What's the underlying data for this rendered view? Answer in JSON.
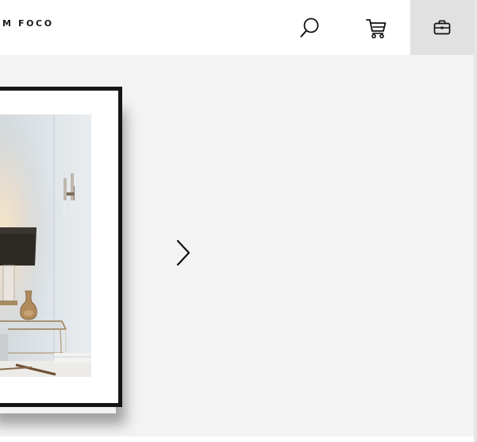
{
  "header": {
    "brand": "M FOCO",
    "icons": {
      "search": "search-icon",
      "cart": "cart-icon",
      "bag": "briefcase-icon"
    }
  },
  "carousel": {
    "next_icon": "chevron-right-icon",
    "image": "framed-photo-living-room-lamp"
  },
  "colors": {
    "page_bg": "#f3f3f3",
    "header_bg": "#ffffff",
    "active_button_bg": "#e1e1e1",
    "frame": "#151515"
  }
}
